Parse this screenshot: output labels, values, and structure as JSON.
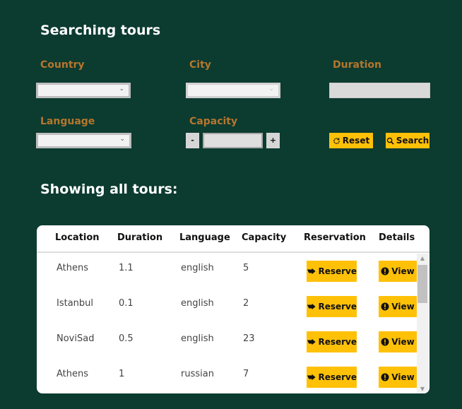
{
  "search": {
    "title": "Searching tours",
    "country_label": "Country",
    "city_label": "City",
    "duration_label": "Duration",
    "language_label": "Language",
    "capacity_label": "Capacity",
    "country_value": "",
    "city_value": "",
    "duration_value": "",
    "language_value": "",
    "capacity_value": "",
    "decrement": "-",
    "increment": "+",
    "reset_label": "Reset",
    "search_label": "Search"
  },
  "results": {
    "title": "Showing all tours:",
    "columns": [
      "Location",
      "Duration",
      "Language",
      "Capacity",
      "Reservation",
      "Details"
    ],
    "reserve_label": "Reserve",
    "view_label": "View",
    "rows": [
      {
        "location": "Athens",
        "duration": "1.1",
        "language": "english",
        "capacity": "5"
      },
      {
        "location": "Istanbul",
        "duration": "0.1",
        "language": "english",
        "capacity": "2"
      },
      {
        "location": "NoviSad",
        "duration": "0.5",
        "language": "english",
        "capacity": "23"
      },
      {
        "location": "Athens",
        "duration": "1",
        "language": "russian",
        "capacity": "7"
      }
    ]
  },
  "colors": {
    "background": "#0c3b30",
    "label": "#b5762d",
    "button": "#ffc107"
  },
  "icons": {
    "reset": "refresh-icon",
    "search": "search-icon",
    "reserve": "reserve-arrow-icon",
    "view": "info-icon"
  }
}
